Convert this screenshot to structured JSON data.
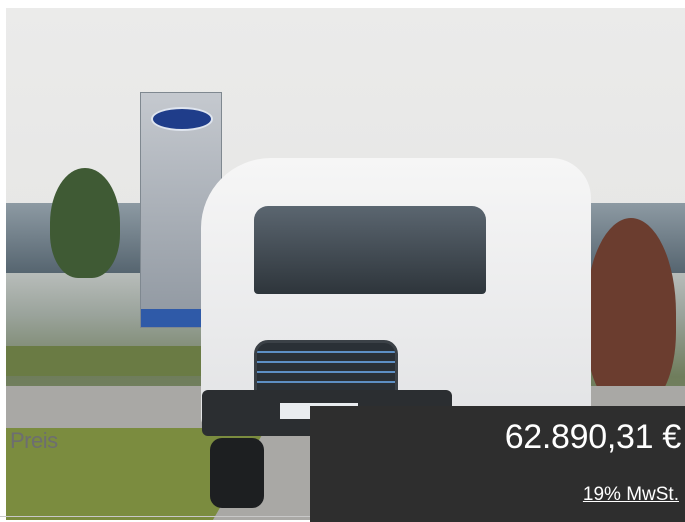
{
  "photo": {
    "alt_subject": "van-photo"
  },
  "price": {
    "label": "Preis",
    "value": "62.890,31 €",
    "vat_note": "19% MwSt."
  },
  "colors": {
    "price_box": "#2e2e2e",
    "price_text": "#ffffff",
    "label_text": "#6d6e70"
  }
}
